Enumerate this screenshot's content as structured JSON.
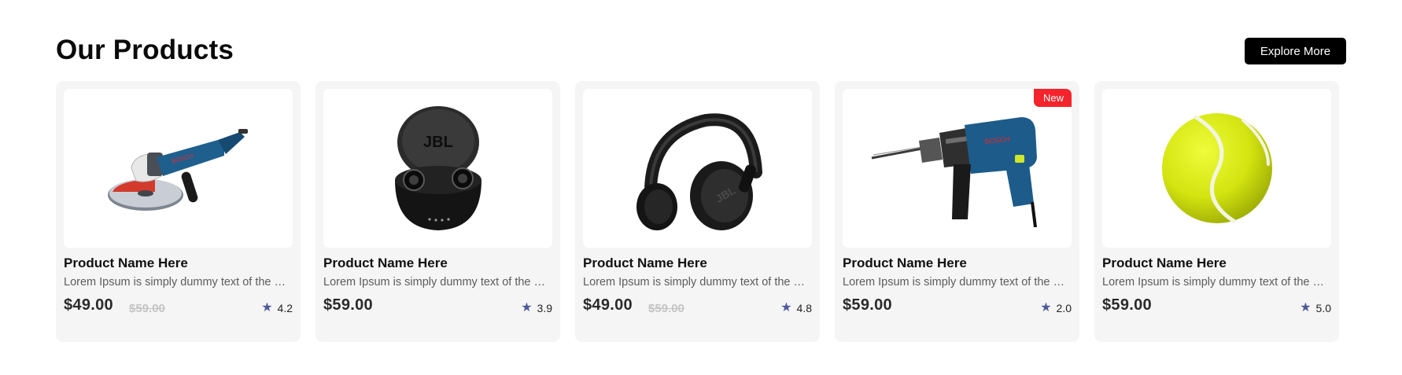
{
  "section": {
    "title": "Our Products",
    "explore_label": "Explore More"
  },
  "products": [
    {
      "image": "angle-grinder",
      "name": "Product Name Here",
      "description": "Lorem Ipsum is simply dummy text of the printing and typesetting industry.",
      "price": "$49.00",
      "old_price": "$59.00",
      "rating": "4.2"
    },
    {
      "image": "wireless-earbuds",
      "name": "Product Name Here",
      "description": "Lorem Ipsum is simply dummy text of the printing and typesetting industry.",
      "price": "$59.00",
      "old_price": "",
      "rating": "3.9"
    },
    {
      "image": "headphones",
      "name": "Product Name Here",
      "description": "Lorem Ipsum is simply dummy text of the printing and typesetting industry.",
      "price": "$49.00",
      "old_price": "$59.00",
      "rating": "4.8"
    },
    {
      "image": "power-drill",
      "badge": "New",
      "name": "Product Name Here",
      "description": "Lorem Ipsum is simply dummy text of the printing and typesetting industry.",
      "price": "$59.00",
      "old_price": "",
      "rating": "2.0"
    },
    {
      "image": "tennis-ball",
      "name": "Product Name Here",
      "description": "Lorem Ipsum is simply dummy text of the printing and typesetting industry.",
      "price": "$59.00",
      "old_price": "",
      "rating": "5.0"
    }
  ],
  "colors": {
    "badge": "#f5232b",
    "star": "#4f5a9b",
    "button": "#000000",
    "card": "#f5f5f5"
  }
}
